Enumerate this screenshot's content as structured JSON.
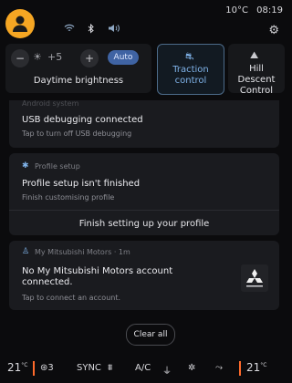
{
  "statusbar": {
    "temperature": "10°C",
    "time": "08:19",
    "icons": [
      "wifi-icon",
      "bluetooth-icon",
      "volume-icon",
      "settings-icon"
    ]
  },
  "quick_settings": {
    "brightness_step": "+5",
    "brightness_minus": "−",
    "brightness_plus": "+",
    "auto_label": "Auto",
    "brightness_label": "Daytime brightness",
    "traction_label": "Traction control",
    "hill_label": "Hill Descent Control"
  },
  "notifications": [
    {
      "source": "Android system",
      "title": "USB debugging connected",
      "subtitle": "Tap to turn off USB debugging"
    },
    {
      "source": "Profile setup",
      "title": "Profile setup isn't finished",
      "subtitle": "Finish customising profile",
      "action": "Finish setting up your profile"
    },
    {
      "source": "My Mitsubishi Motors · 1m",
      "title": "No My Mitsubishi Motors account connected.",
      "subtitle": "Tap to connect an account.",
      "logo_text": "MITSUBISHI MOTORS"
    }
  ],
  "clear_all": "Clear all",
  "bottom_bar": {
    "left_temp": "21",
    "left_temp_unit": "°C",
    "seat_level": "3",
    "sync": "SYNC",
    "ac": "A/C",
    "right_temp": "21",
    "right_temp_unit": "°C"
  },
  "colors": {
    "avatar": "#f5a623",
    "accent_blue": "#7fb2e8",
    "auto_badge": "#3f63a3",
    "temp_accent": "#ff6a2b"
  }
}
